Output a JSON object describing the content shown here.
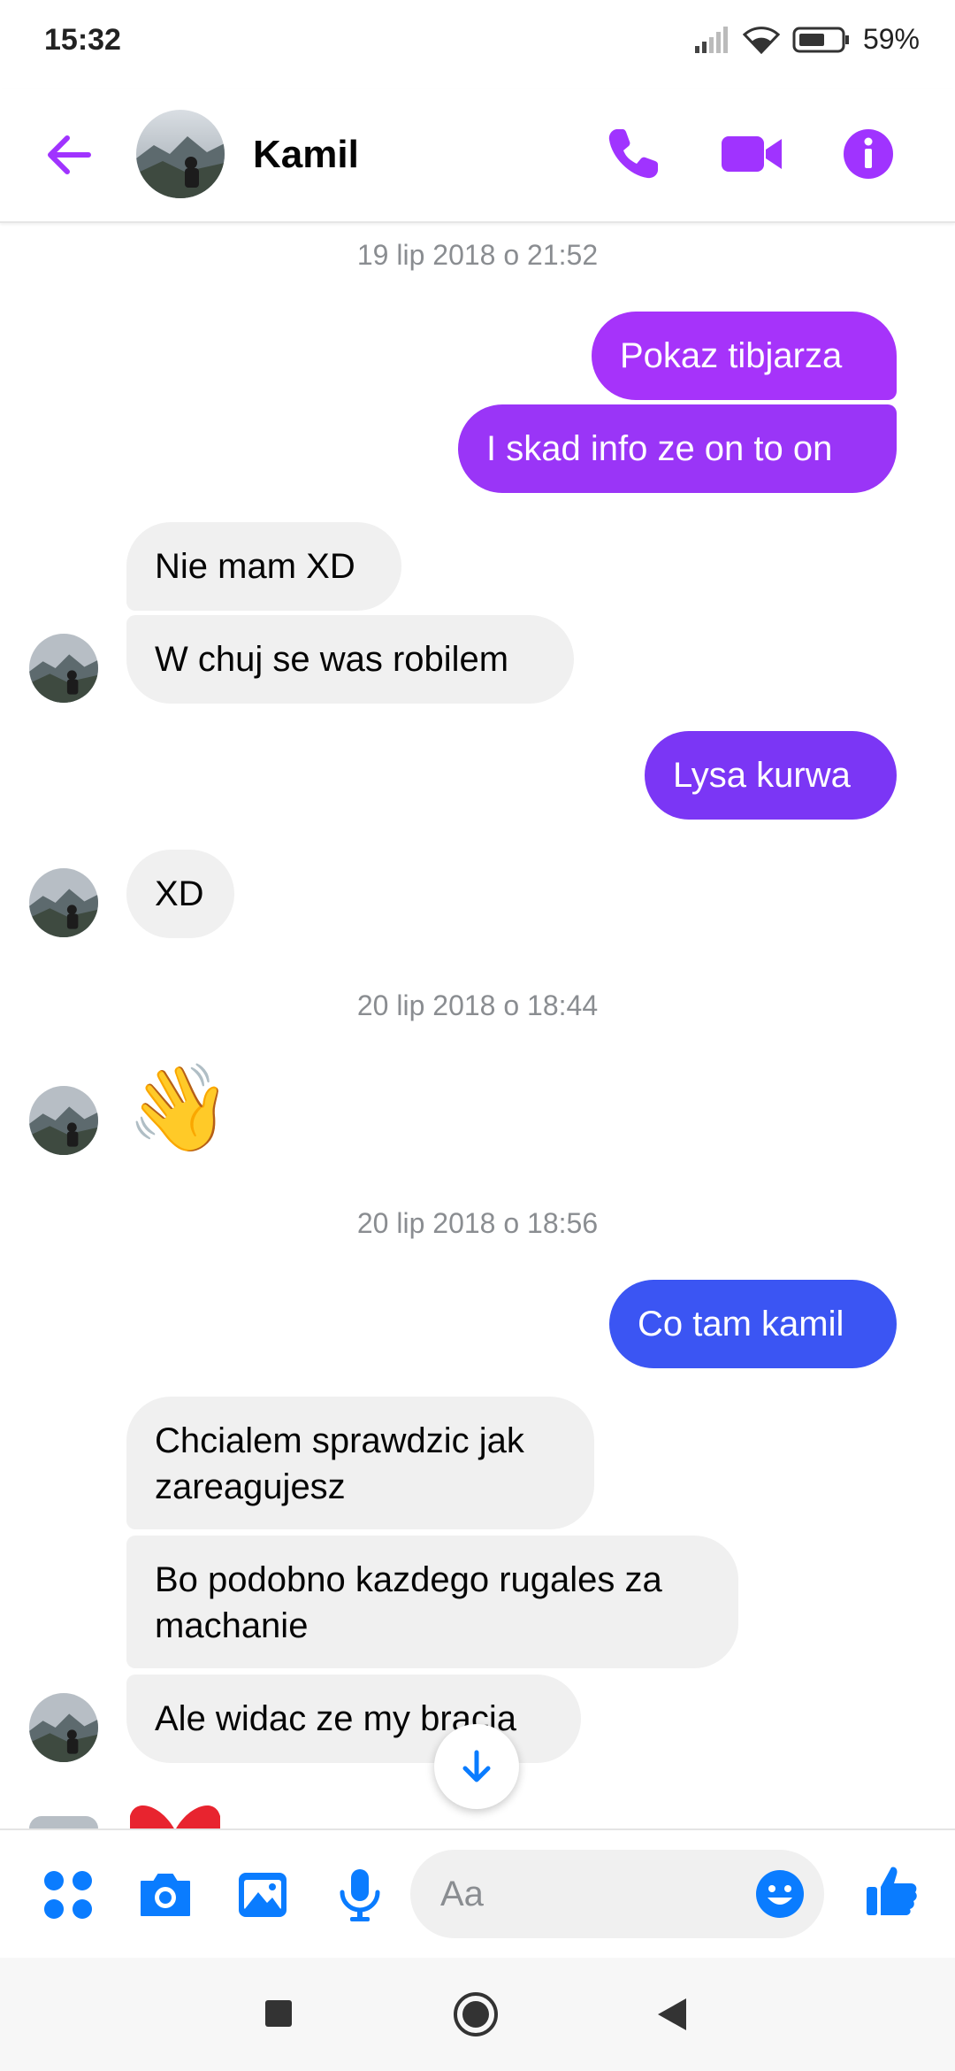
{
  "status_bar": {
    "time": "15:32",
    "battery": "59%"
  },
  "header": {
    "contact_name": "Kamil"
  },
  "timestamps": [
    "19 lip 2018 o 21:52",
    "20 lip 2018 o 18:44",
    "20 lip 2018 o 18:56"
  ],
  "messages": {
    "m1": "Pokaz tibjarza",
    "m2": "I skad info ze on to on",
    "m3": "Nie mam XD",
    "m4": "W chuj se was robilem",
    "m5": "Lysa kurwa",
    "m6": "XD",
    "m7": "👋",
    "m8": "Co tam kamil",
    "m9": "Chcialem sprawdzic jak\nzareagujesz",
    "m10": "Bo podobno kazdego rugales za\nmachanie",
    "m11": "Ale widac ze my bracia"
  },
  "composer": {
    "placeholder": "Aa"
  },
  "colors": {
    "accent": "#a033ff",
    "blue": "#0a7cff",
    "violet": "#7b36f5",
    "indigo": "#3b55f3"
  }
}
